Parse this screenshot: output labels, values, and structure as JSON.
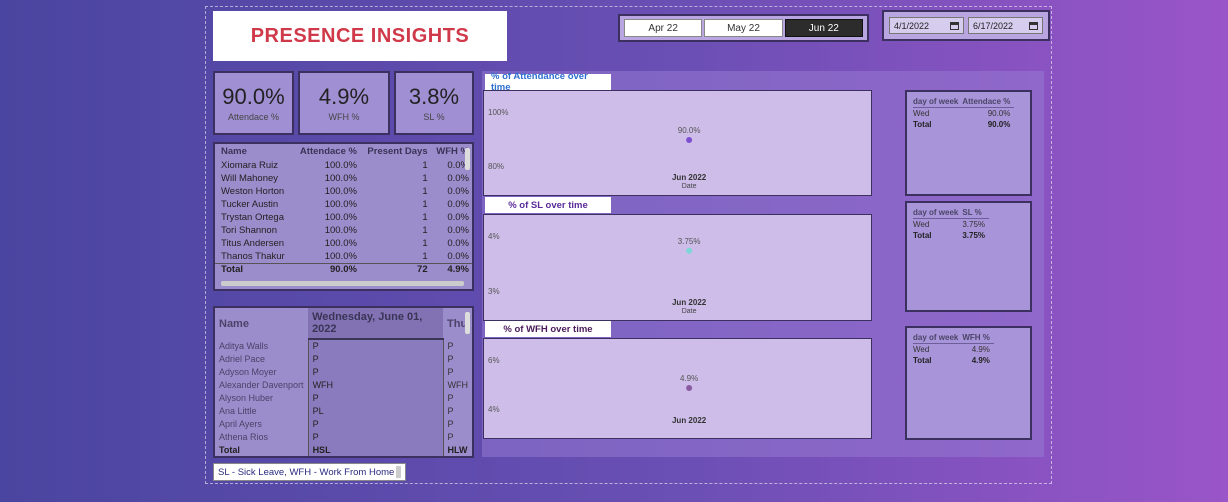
{
  "title": "PRESENCE INSIGHTS",
  "month_slicer": {
    "options": [
      "Apr 22",
      "May 22",
      "Jun 22"
    ],
    "selected": "Jun 22"
  },
  "date_range": {
    "start": "4/1/2022",
    "end": "6/17/2022",
    "icon": "calendar-icon"
  },
  "kpis": [
    {
      "value": "90.0%",
      "label": "Attendace %"
    },
    {
      "value": "4.9%",
      "label": "WFH %"
    },
    {
      "value": "3.8%",
      "label": "SL %"
    }
  ],
  "employee_table": {
    "columns": [
      "Name",
      "Attendace %",
      "Present Days",
      "WFH %"
    ],
    "rows": [
      [
        "Xiomara Ruiz",
        "100.0%",
        "1",
        "0.0%"
      ],
      [
        "Will Mahoney",
        "100.0%",
        "1",
        "0.0%"
      ],
      [
        "Weston Horton",
        "100.0%",
        "1",
        "0.0%"
      ],
      [
        "Tucker Austin",
        "100.0%",
        "1",
        "0.0%"
      ],
      [
        "Trystan Ortega",
        "100.0%",
        "1",
        "0.0%"
      ],
      [
        "Tori Shannon",
        "100.0%",
        "1",
        "0.0%"
      ],
      [
        "Titus Andersen",
        "100.0%",
        "1",
        "0.0%"
      ],
      [
        "Thanos Thakur",
        "100.0%",
        "1",
        "0.0%"
      ]
    ],
    "total": [
      "Total",
      "90.0%",
      "72",
      "4.9%"
    ]
  },
  "daily_matrix": {
    "columns": [
      "Name",
      "Wednesday, June 01, 2022",
      "Thu"
    ],
    "rows": [
      [
        "Aditya Walls",
        "P",
        "P"
      ],
      [
        "Adriel Pace",
        "P",
        "P"
      ],
      [
        "Adyson Moyer",
        "P",
        "P"
      ],
      [
        "Alexander Davenport",
        "WFH",
        "WFH"
      ],
      [
        "Alyson Huber",
        "P",
        "P"
      ],
      [
        "Ana Little",
        "PL",
        "P"
      ],
      [
        "April Ayers",
        "P",
        "P"
      ],
      [
        "Athena Rios",
        "P",
        "P"
      ]
    ],
    "total": [
      "Total",
      "HSL",
      "HLW"
    ]
  },
  "legend_note": "SL - Sick Leave, WFH - Work From Home",
  "chart_data": [
    {
      "type": "scatter",
      "title": "% of Attendance over time",
      "x": [
        "Jun 2022"
      ],
      "xlabel": "Date",
      "y_ticks": [
        "100%",
        "80%"
      ],
      "ylim": [
        80,
        100
      ],
      "series": [
        {
          "values": [
            90.0
          ],
          "labels": [
            "90.0%"
          ],
          "color": "#7b4fd0"
        }
      ]
    },
    {
      "type": "scatter",
      "title": "% of SL over time",
      "x": [
        "Jun 2022"
      ],
      "xlabel": "Date",
      "y_ticks": [
        "4%",
        "3%"
      ],
      "ylim": [
        3,
        4
      ],
      "series": [
        {
          "values": [
            3.75
          ],
          "labels": [
            "3.75%"
          ],
          "color": "#7fd6d6"
        }
      ]
    },
    {
      "type": "scatter",
      "title": "% of WFH over time",
      "x": [
        "Jun 2022"
      ],
      "xlabel": "",
      "y_ticks": [
        "6%",
        "4%"
      ],
      "ylim": [
        4,
        6
      ],
      "series": [
        {
          "values": [
            4.9
          ],
          "labels": [
            "4.9%"
          ],
          "color": "#8a5aa0"
        }
      ]
    }
  ],
  "dow_tables": [
    {
      "columns": [
        "day of week",
        "Attendace %"
      ],
      "rows": [
        [
          "Wed",
          "90.0%"
        ]
      ],
      "total": [
        "Total",
        "90.0%"
      ]
    },
    {
      "columns": [
        "day of week",
        "SL %"
      ],
      "rows": [
        [
          "Wed",
          "3.75%"
        ]
      ],
      "total": [
        "Total",
        "3.75%"
      ]
    },
    {
      "columns": [
        "day of week",
        "WFH %"
      ],
      "rows": [
        [
          "Wed",
          "4.9%"
        ]
      ],
      "total": [
        "Total",
        "4.9%"
      ]
    }
  ],
  "colors": {
    "title": "#d0394a",
    "attendance_tab": "#2f6fd0",
    "sl_tab": "#5a2a9a",
    "wfh_tab": "#4a1a5a"
  }
}
